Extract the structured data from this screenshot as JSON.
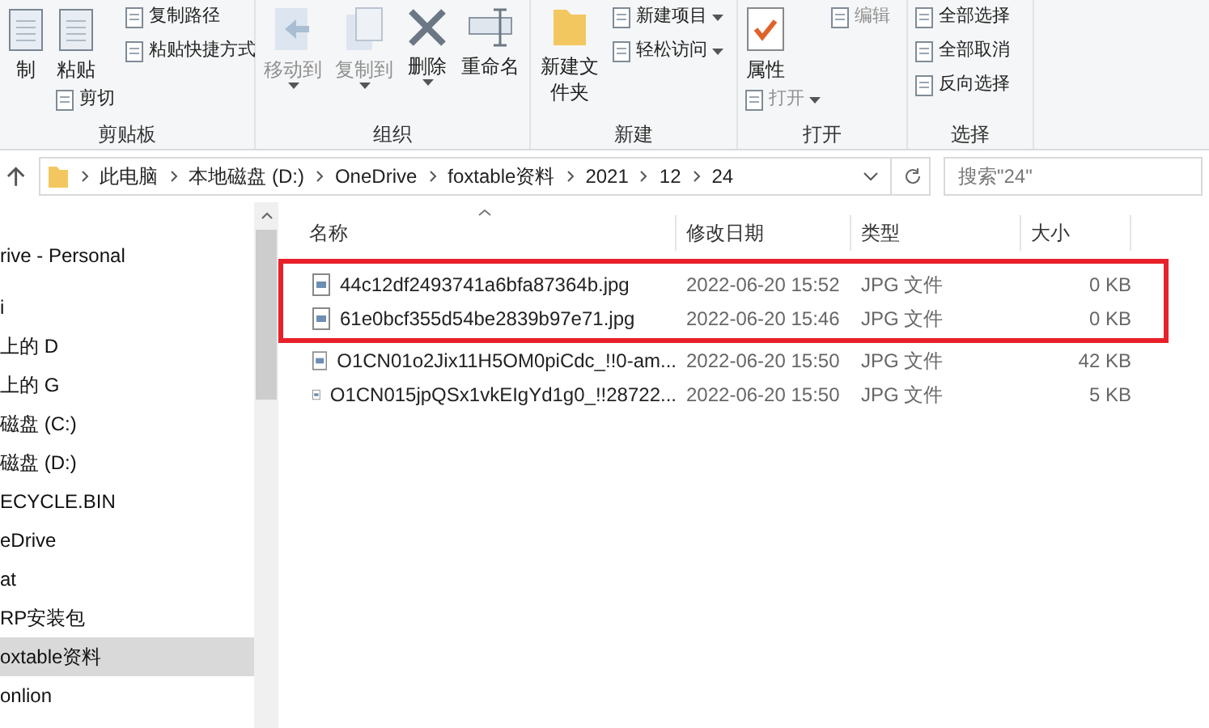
{
  "ribbon": {
    "groups": [
      {
        "label": "剪贴板",
        "columns": [
          [
            {
              "kind": "large",
              "label": "制",
              "disabled": false,
              "dropdown": false
            }
          ],
          [
            {
              "kind": "large",
              "label": "粘贴",
              "disabled": false,
              "dropdown": false
            },
            {
              "kind": "small",
              "label": "剪切",
              "disabled": false,
              "dropdown": false
            }
          ],
          [
            {
              "kind": "small",
              "label": "复制路径",
              "disabled": false,
              "dropdown": false
            },
            {
              "kind": "small",
              "label": "粘贴快捷方式",
              "disabled": false,
              "dropdown": false
            }
          ]
        ]
      },
      {
        "label": "组织",
        "columns": [
          [
            {
              "kind": "large",
              "label": "移动到",
              "disabled": true,
              "dropdown": true
            }
          ],
          [
            {
              "kind": "large",
              "label": "复制到",
              "disabled": true,
              "dropdown": true
            }
          ],
          [
            {
              "kind": "large",
              "label": "删除",
              "disabled": false,
              "dropdown": true
            }
          ],
          [
            {
              "kind": "large",
              "label": "重命名",
              "disabled": false,
              "dropdown": false
            }
          ]
        ]
      },
      {
        "label": "新建",
        "columns": [
          [
            {
              "kind": "large",
              "label": "新建文件夹",
              "disabled": false,
              "dropdown": false
            }
          ],
          [
            {
              "kind": "small",
              "label": "新建项目",
              "disabled": false,
              "dropdown": true
            },
            {
              "kind": "small",
              "label": "轻松访问",
              "disabled": false,
              "dropdown": true
            }
          ]
        ]
      },
      {
        "label": "打开",
        "columns": [
          [
            {
              "kind": "large",
              "label": "属性",
              "disabled": false,
              "dropdown": false
            },
            {
              "kind": "small",
              "label": "打开",
              "disabled": true,
              "dropdown": true
            }
          ],
          [
            {
              "kind": "small",
              "label": "编辑",
              "disabled": true,
              "dropdown": false
            }
          ]
        ]
      },
      {
        "label": "选择",
        "columns": [
          [
            {
              "kind": "small",
              "label": "全部选择",
              "disabled": false,
              "dropdown": false
            },
            {
              "kind": "small",
              "label": "全部取消",
              "disabled": false,
              "dropdown": false
            },
            {
              "kind": "small",
              "label": "反向选择",
              "disabled": false,
              "dropdown": false
            }
          ]
        ]
      }
    ]
  },
  "address_bar": {
    "crumbs": [
      "此电脑",
      "本地磁盘 (D:)",
      "OneDrive",
      "foxtable资料",
      "2021",
      "12",
      "24"
    ]
  },
  "search": {
    "placeholder": "搜索\"24\""
  },
  "nav_pane": {
    "items": [
      {
        "label": "rive - Personal",
        "selected": false
      },
      {
        "label": "i",
        "selected": false
      },
      {
        "label": "上的 D",
        "selected": false
      },
      {
        "label": "上的 G",
        "selected": false
      },
      {
        "label": "磁盘 (C:)",
        "selected": false
      },
      {
        "label": "磁盘 (D:)",
        "selected": false
      },
      {
        "label": "ECYCLE.BIN",
        "selected": false
      },
      {
        "label": "eDrive",
        "selected": false
      },
      {
        "label": "at",
        "selected": false
      },
      {
        "label": "RP安装包",
        "selected": false
      },
      {
        "label": "oxtable资料",
        "selected": true
      },
      {
        "label": "onlion",
        "selected": false
      }
    ]
  },
  "file_list": {
    "columns": [
      "名称",
      "修改日期",
      "类型",
      "大小"
    ],
    "rows": [
      {
        "name": "44c12df2493741a6bfa87364b.jpg",
        "date": "2022-06-20 15:52",
        "type": "JPG 文件",
        "size": "0 KB",
        "highlighted": true
      },
      {
        "name": "61e0bcf355d54be2839b97e71.jpg",
        "date": "2022-06-20 15:46",
        "type": "JPG 文件",
        "size": "0 KB",
        "highlighted": true
      },
      {
        "name": "O1CN01o2Jix11H5OM0piCdc_!!0-am...",
        "date": "2022-06-20 15:50",
        "type": "JPG 文件",
        "size": "42 KB",
        "highlighted": false
      },
      {
        "name": "O1CN015jpQSx1vkEIgYd1g0_!!28722...",
        "date": "2022-06-20 15:50",
        "type": "JPG 文件",
        "size": "5 KB",
        "highlighted": false
      }
    ]
  }
}
